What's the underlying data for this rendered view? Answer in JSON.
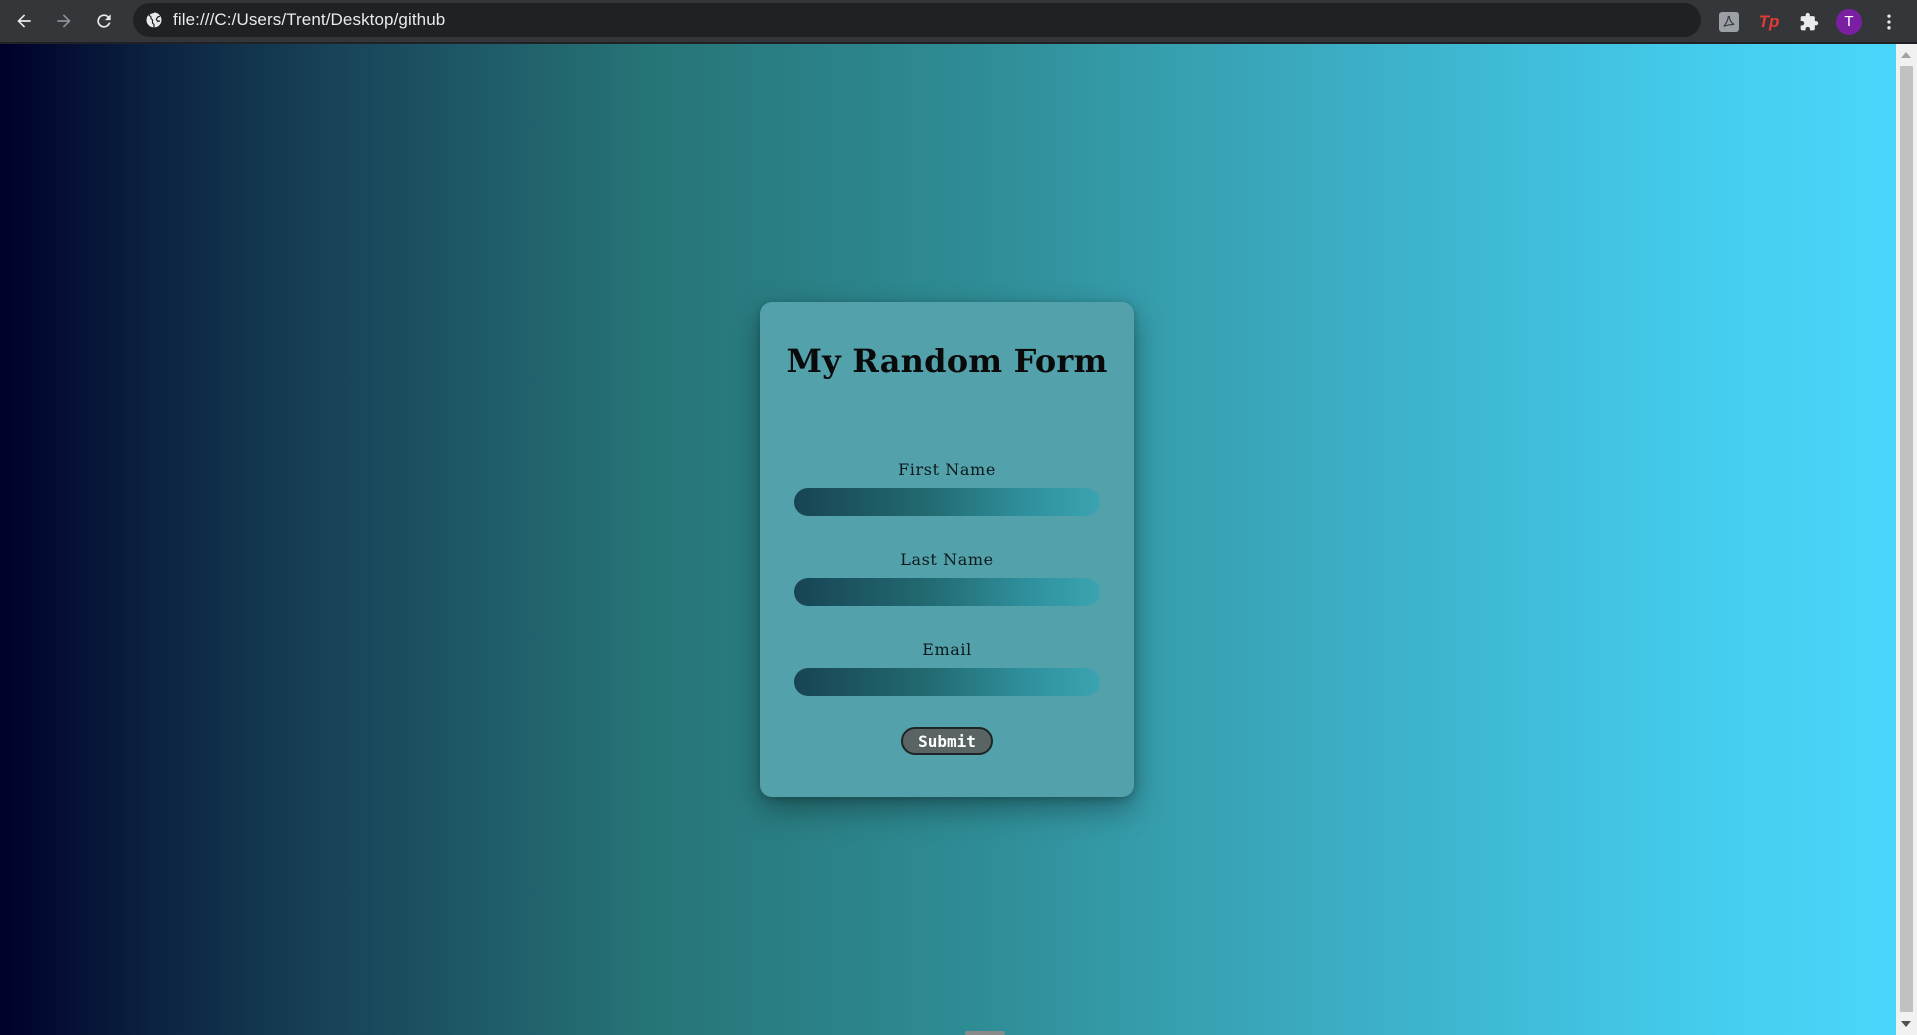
{
  "browser": {
    "url": "file:///C:/Users/Trent/Desktop/github",
    "back_icon": "arrow-left-icon",
    "forward_icon": "arrow-right-icon",
    "reload_icon": "reload-icon",
    "site_info_icon": "globe-icon",
    "extensions": [
      {
        "name": "pdf-extension-icon"
      },
      {
        "name": "tp-extension-icon",
        "label": "Tp"
      },
      {
        "name": "puzzle-extensions-icon"
      }
    ],
    "profile_initial": "T",
    "menu_icon": "kebab-menu-icon"
  },
  "page": {
    "background_colors": [
      "#00002a",
      "#267476",
      "#4ad6fb"
    ],
    "card_color": "#53a1ab"
  },
  "form": {
    "title": "My Random Form",
    "fields": [
      {
        "label": "First Name",
        "value": ""
      },
      {
        "label": "Last Name",
        "value": ""
      },
      {
        "label": "Email",
        "value": ""
      }
    ],
    "submit_label": "Submit"
  }
}
